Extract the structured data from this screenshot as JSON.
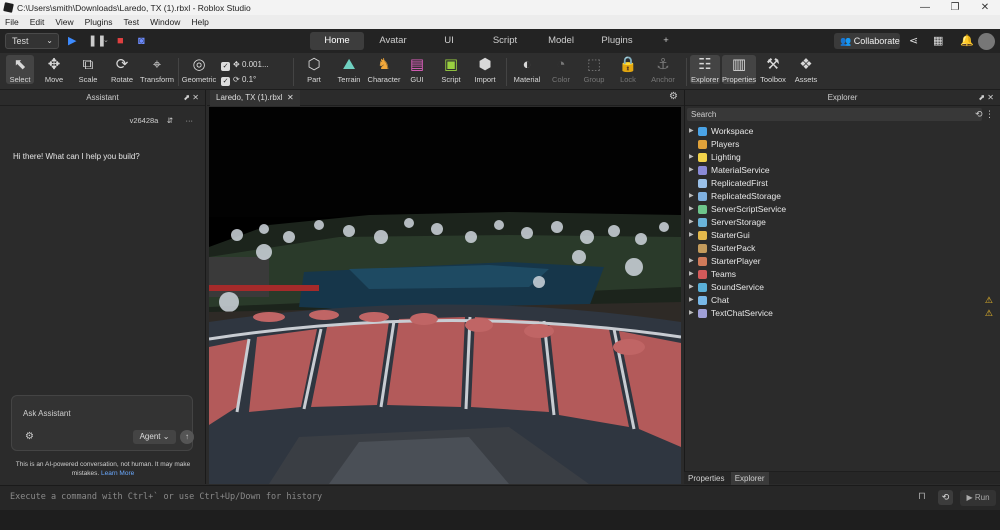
{
  "window": {
    "title": "C:\\Users\\smith\\Downloads\\Laredo, TX (1).rbxl - Roblox Studio",
    "controls": [
      "—",
      "❐",
      "✕"
    ]
  },
  "menu": [
    "File",
    "Edit",
    "View",
    "Plugins",
    "Test",
    "Window",
    "Help"
  ],
  "top": {
    "test_select": "Test",
    "tabs": [
      "Home",
      "Avatar",
      "UI",
      "Script",
      "Model",
      "Plugins",
      "+"
    ],
    "active_tab": "Home",
    "collaborate_label": "Collaborate"
  },
  "ribbon": {
    "tools": [
      "Select",
      "Move",
      "Scale",
      "Rotate",
      "Transform"
    ],
    "geometric_label": "Geometric",
    "move_increment": "0.001...",
    "rotate_increment": "0.1°",
    "insert": [
      "Part",
      "Terrain",
      "Character",
      "GUI",
      "Script",
      "Import"
    ],
    "edit": [
      "Material",
      "Color",
      "Group",
      "Lock",
      "Anchor"
    ],
    "windows": [
      "Explorer",
      "Properties",
      "Toolbox",
      "Assets"
    ]
  },
  "assistant": {
    "title": "Assistant",
    "version": "v26428a",
    "greeting": "Hi there! What can I help you build?",
    "input_placeholder": "Ask Assistant",
    "mode": "Agent",
    "disclaimer": "This is an AI-powered conversation, not human. It may make mistakes.",
    "learn_more": "Learn More"
  },
  "viewport": {
    "tab_label": "Laredo, TX (1).rbxl"
  },
  "explorer": {
    "title": "Explorer",
    "search_placeholder": "Search",
    "items": [
      {
        "name": "Workspace",
        "expandable": true,
        "color": "#4aa3e6",
        "warning": false
      },
      {
        "name": "Players",
        "expandable": false,
        "color": "#e0a23a",
        "warning": false
      },
      {
        "name": "Lighting",
        "expandable": true,
        "color": "#f2d34b",
        "warning": false
      },
      {
        "name": "MaterialService",
        "expandable": true,
        "color": "#8a8ad8",
        "warning": false
      },
      {
        "name": "ReplicatedFirst",
        "expandable": false,
        "color": "#9ac0e8",
        "warning": false
      },
      {
        "name": "ReplicatedStorage",
        "expandable": true,
        "color": "#7fb0e0",
        "warning": false
      },
      {
        "name": "ServerScriptService",
        "expandable": true,
        "color": "#6dc48b",
        "warning": false
      },
      {
        "name": "ServerStorage",
        "expandable": true,
        "color": "#6ab3d8",
        "warning": false
      },
      {
        "name": "StarterGui",
        "expandable": true,
        "color": "#e4b84b",
        "warning": false
      },
      {
        "name": "StarterPack",
        "expandable": false,
        "color": "#c49b5c",
        "warning": false
      },
      {
        "name": "StarterPlayer",
        "expandable": true,
        "color": "#d07a5a",
        "warning": false
      },
      {
        "name": "Teams",
        "expandable": true,
        "color": "#d45a5a",
        "warning": false
      },
      {
        "name": "SoundService",
        "expandable": true,
        "color": "#5ab0d8",
        "warning": false
      },
      {
        "name": "Chat",
        "expandable": true,
        "color": "#78b8e8",
        "warning": true
      },
      {
        "name": "TextChatService",
        "expandable": true,
        "color": "#a0a0d8",
        "warning": true
      }
    ],
    "bottom_tabs": [
      "Properties",
      "Explorer"
    ],
    "active_bottom_tab": "Explorer"
  },
  "command_bar": {
    "placeholder": "Execute a command with Ctrl+` or use Ctrl+Up/Down for history",
    "run_label": "Run"
  }
}
